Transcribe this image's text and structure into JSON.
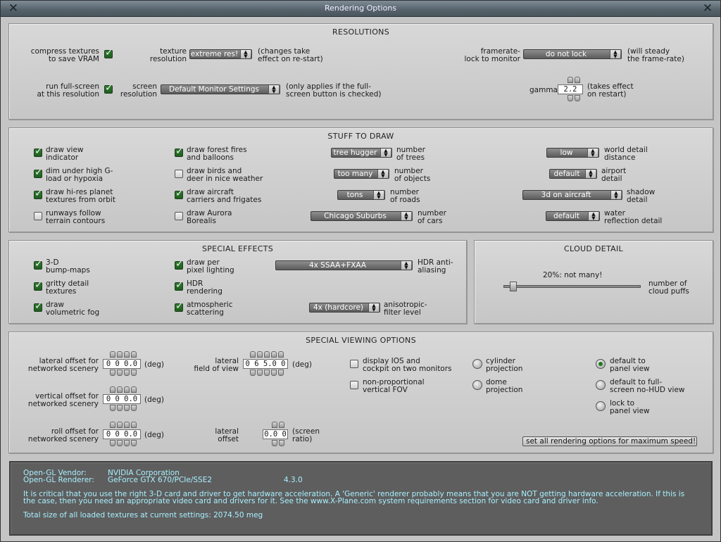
{
  "window": {
    "title": "Rendering Options"
  },
  "resolutions": {
    "title": "RESOLUTIONS",
    "compress_textures": {
      "label_1": "compress textures",
      "label_2": "to save VRAM",
      "checked": true
    },
    "texture_resolution": {
      "label_1": "texture",
      "label_2": "resolution",
      "value": "extreme res!",
      "note_1": "(changes take",
      "note_2": "effect on re-start)"
    },
    "framerate_lock": {
      "label_1": "framerate-",
      "label_2": "lock to monitor",
      "value": "do not lock",
      "note_1": "(will steady",
      "note_2": "the frame-rate)"
    },
    "run_fullscreen": {
      "label_1": "run full-screen",
      "label_2": "at this resolution",
      "checked": true
    },
    "screen_resolution": {
      "label_1": "screen",
      "label_2": "resolution",
      "value": "Default Monitor Settings",
      "note_1": "(only applies if the full-",
      "note_2": "screen button is checked)"
    },
    "gamma": {
      "label": "gamma",
      "value": "2.2",
      "note_1": "(takes effect",
      "note_2": "on restart)"
    }
  },
  "stuff_to_draw": {
    "title": "STUFF TO DRAW",
    "checkboxes": [
      {
        "label_1": "draw view",
        "label_2": "indicator",
        "checked": true
      },
      {
        "label_1": "dim under high G-",
        "label_2": "load or hypoxia",
        "checked": true
      },
      {
        "label_1": "draw hi-res planet",
        "label_2": "textures from orbit",
        "checked": true
      },
      {
        "label_1": "runways follow",
        "label_2": "terrain contours",
        "checked": false
      },
      {
        "label_1": "draw forest fires",
        "label_2": "and balloons",
        "checked": true
      },
      {
        "label_1": "draw birds and",
        "label_2": "deer in nice weather",
        "checked": false
      },
      {
        "label_1": "draw aircraft",
        "label_2": "carriers and frigates",
        "checked": true
      },
      {
        "label_1": "draw Aurora",
        "label_2": "Borealis",
        "checked": false
      }
    ],
    "dropdowns_mid": [
      {
        "value": "tree hugger",
        "label_1": "number",
        "label_2": "of trees"
      },
      {
        "value": "too many",
        "label_1": "number",
        "label_2": "of objects"
      },
      {
        "value": "tons",
        "label_1": "number",
        "label_2": "of roads"
      },
      {
        "value": "Chicago Suburbs",
        "label_1": "number",
        "label_2": "of cars"
      }
    ],
    "dropdowns_right": [
      {
        "value": "low",
        "label_1": "world detail",
        "label_2": "distance"
      },
      {
        "value": "default",
        "label_1": "airport",
        "label_2": "detail"
      },
      {
        "value": "3d on aircraft",
        "label_1": "shadow",
        "label_2": "detail"
      },
      {
        "value": "default",
        "label_1": "water",
        "label_2": "reflection detail"
      }
    ]
  },
  "special_effects": {
    "title": "SPECIAL EFFECTS",
    "checkboxes": [
      {
        "label_1": "3-D",
        "label_2": "bump-maps",
        "checked": true
      },
      {
        "label_1": "gritty detail",
        "label_2": "textures",
        "checked": true
      },
      {
        "label_1": "draw",
        "label_2": "volumetric fog",
        "checked": true
      },
      {
        "label_1": "draw per",
        "label_2": "pixel lighting",
        "checked": true
      },
      {
        "label_1": "HDR",
        "label_2": "rendering",
        "checked": true
      },
      {
        "label_1": "atmospheric",
        "label_2": "scattering",
        "checked": true
      }
    ],
    "antialiasing": {
      "value": "4x SSAA+FXAA",
      "label_1": "HDR anti-",
      "label_2": "aliasing"
    },
    "anisotropic": {
      "value": "4x (hardcore)",
      "label_1": "anisotropic-",
      "label_2": "filter level"
    }
  },
  "cloud_detail": {
    "title": "CLOUD DETAIL",
    "value_text": "20%: not many!",
    "level": 0.05,
    "label_1": "number of",
    "label_2": "cloud puffs"
  },
  "viewing": {
    "title": "SPECIAL VIEWING OPTIONS",
    "lateral_offset": {
      "label_1": "lateral offset for",
      "label_2": "networked scenery",
      "value": "0 0 0.0",
      "unit": "(deg)"
    },
    "vertical_offset": {
      "label_1": "vertical offset for",
      "label_2": "networked scenery",
      "value": "0 0 0.0",
      "unit": "(deg)"
    },
    "roll_offset": {
      "label_1": "roll offset for",
      "label_2": "networked scenery",
      "value": "0 0 0.0",
      "unit": "(deg)"
    },
    "lateral_fov": {
      "label_1": "lateral",
      "label_2": "field of view",
      "value": "0 6 5.0 0",
      "unit": "(deg)"
    },
    "lateral_screen_offset": {
      "label_1": "lateral",
      "label_2": "offset",
      "value": "0.0 0",
      "unit_1": "(screen",
      "unit_2": "ratio)"
    },
    "ios_cockpit": {
      "label_1": "display IOS and",
      "label_2": "cockpit on two monitors",
      "checked": false
    },
    "nonprop_fov": {
      "label_1": "non-proportional",
      "label_2": "vertical FOV",
      "checked": false
    },
    "projection": [
      {
        "label_1": "cylinder",
        "label_2": "projection",
        "selected": false
      },
      {
        "label_1": "dome",
        "label_2": "projection",
        "selected": false
      }
    ],
    "default_view": [
      {
        "label_1": "default to",
        "label_2": "panel view",
        "selected": true
      },
      {
        "label_1": "default to full-",
        "label_2": "screen no-HUD view",
        "selected": false
      },
      {
        "label_1": "lock to",
        "label_2": "panel view",
        "selected": false
      }
    ],
    "max_speed_button": "set all rendering options for maximum speed!"
  },
  "info": {
    "vendor_label": "Open-GL Vendor:",
    "vendor_value": "NVIDIA Corporation",
    "renderer_label": "Open-GL Renderer:",
    "renderer_value": "GeForce GTX 670/PCIe/SSE2",
    "version": "4.3.0",
    "warning_1": "It is critical that you use the right 3-D card and driver to get hardware acceleration. A 'Generic' renderer probably means that you are NOT getting hardware acceleration. If this is",
    "warning_2": "the case, then you need an appropriate video card and drivers for it. See the www.X-Plane.com system requirements section for video card and driver info.",
    "texture_total": "Total size of all loaded textures at current settings: 2074.50 meg"
  }
}
